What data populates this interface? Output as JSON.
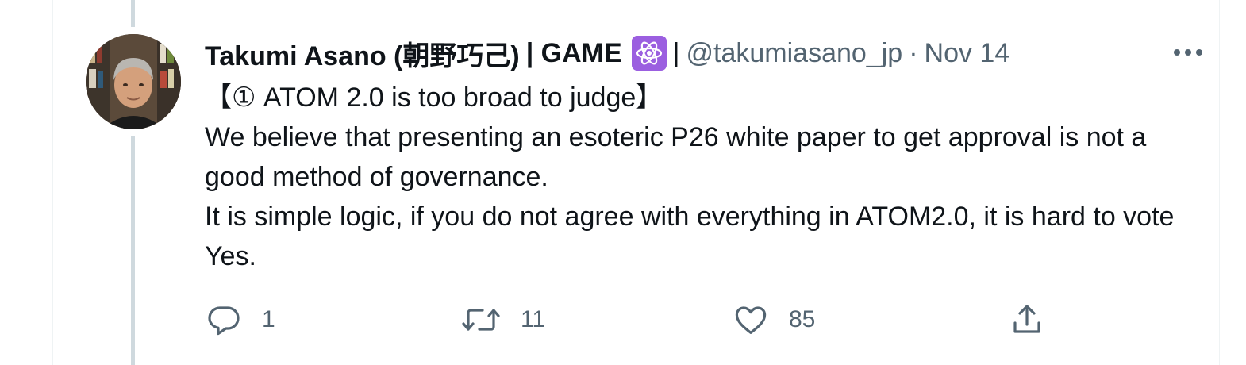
{
  "author": {
    "display_name": "Takumi Asano (朝野巧己)",
    "name_suffix": "| GAME",
    "badge_icon": "atom-icon",
    "badge_color": "#9b5fe0",
    "separator": "|",
    "handle": "@takumiasano_jp",
    "dot": "·",
    "date": "Nov 14"
  },
  "tweet": {
    "lines": [
      "【① ATOM 2.0 is too broad to judge】",
      "We believe that presenting an esoteric P26 white paper to get approval is not a good method of governance.",
      "It is simple logic, if you do not agree with everything in ATOM2.0, it is hard to vote Yes."
    ]
  },
  "actions": {
    "reply": {
      "icon": "reply-icon",
      "count": "1"
    },
    "retweet": {
      "icon": "retweet-icon",
      "count": "11"
    },
    "like": {
      "icon": "heart-icon",
      "count": "85"
    },
    "share": {
      "icon": "share-icon"
    }
  },
  "colors": {
    "text": "#0f1419",
    "secondary": "#536471",
    "thread_line": "#cfd9de"
  }
}
